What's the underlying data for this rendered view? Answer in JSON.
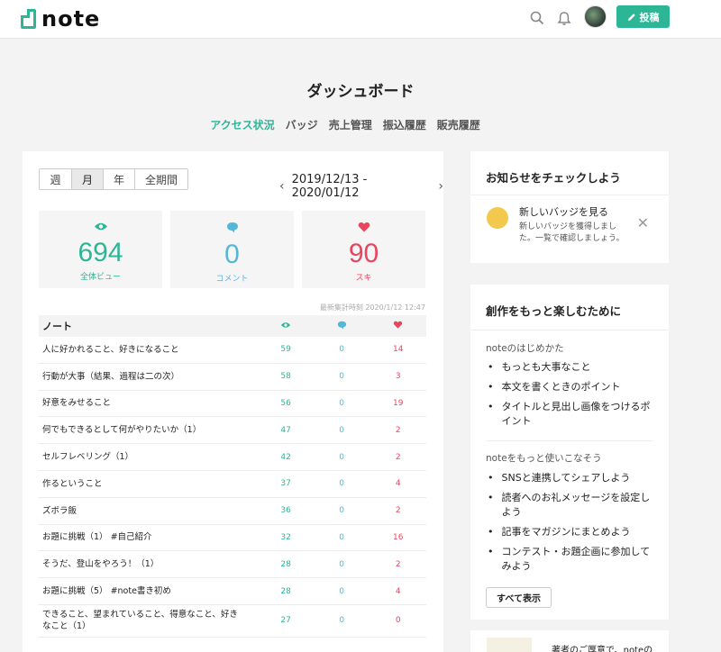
{
  "header": {
    "logo_text": "note",
    "post_label": "投稿"
  },
  "page_title": "ダッシュボード",
  "tabs": [
    {
      "label": "アクセス状況",
      "active": true
    },
    {
      "label": "バッジ"
    },
    {
      "label": "売上管理"
    },
    {
      "label": "振込履歴"
    },
    {
      "label": "販売履歴"
    }
  ],
  "period": {
    "options": [
      "週",
      "月",
      "年",
      "全期間"
    ],
    "selected": "月",
    "range": "2019/12/13 - 2020/01/12"
  },
  "stats": {
    "views": {
      "value": "694",
      "label": "全体ビュー",
      "color": "#2cb696"
    },
    "comments": {
      "value": "0",
      "label": "コメント",
      "color": "#53b8d8"
    },
    "likes": {
      "value": "90",
      "label": "スキ",
      "color": "#e8465f"
    }
  },
  "updated": "最新集計時刻 2020/1/12 12:47",
  "table": {
    "header": "ノート",
    "rows": [
      {
        "title": "人に好かれること、好きになること",
        "views": "59",
        "comments": "0",
        "likes": "14"
      },
      {
        "title": "行動が大事（結果、過程は二の次）",
        "views": "58",
        "comments": "0",
        "likes": "3"
      },
      {
        "title": "好意をみせること",
        "views": "56",
        "comments": "0",
        "likes": "19"
      },
      {
        "title": "何でもできるとして何がやりたいか（1）",
        "views": "47",
        "comments": "0",
        "likes": "2"
      },
      {
        "title": "セルフレベリング（1）",
        "views": "42",
        "comments": "0",
        "likes": "2"
      },
      {
        "title": "作るということ",
        "views": "37",
        "comments": "0",
        "likes": "4"
      },
      {
        "title": "ズボラ飯",
        "views": "36",
        "comments": "0",
        "likes": "2"
      },
      {
        "title": "お題に挑戦（1） #自己紹介",
        "views": "32",
        "comments": "0",
        "likes": "16"
      },
      {
        "title": "そうだ、登山をやろう！（1）",
        "views": "28",
        "comments": "0",
        "likes": "2"
      },
      {
        "title": "お題に挑戦（5） #note書き初め",
        "views": "28",
        "comments": "0",
        "likes": "4"
      },
      {
        "title": "できること、望まれていること、得意なこと、好きなこと（1）",
        "views": "27",
        "comments": "0",
        "likes": "0"
      }
    ]
  },
  "news": {
    "title": "お知らせをチェックしよう",
    "item_title": "新しいバッジを見る",
    "item_desc": "新しいバッジを獲得しました。一覧で確認しましょう。"
  },
  "guide": {
    "title": "創作をもっと楽しむために",
    "section1": "noteのはじめかた",
    "items1": [
      "もっとも大事なこと",
      "本文を書くときのポイント",
      "タイトルと見出し画像をつけるポイント"
    ],
    "section2": "noteをもっと使いこなそう",
    "items2": [
      "SNSと連携してシェアしよう",
      "読者へのお礼メッセージを設定しよう",
      "記事をマガジンにまとめよう",
      "コンテスト・お題企画に参加してみよう"
    ],
    "show_all": "すべて表示"
  },
  "bottom_card_text": "著者のご厚意で、noteの"
}
